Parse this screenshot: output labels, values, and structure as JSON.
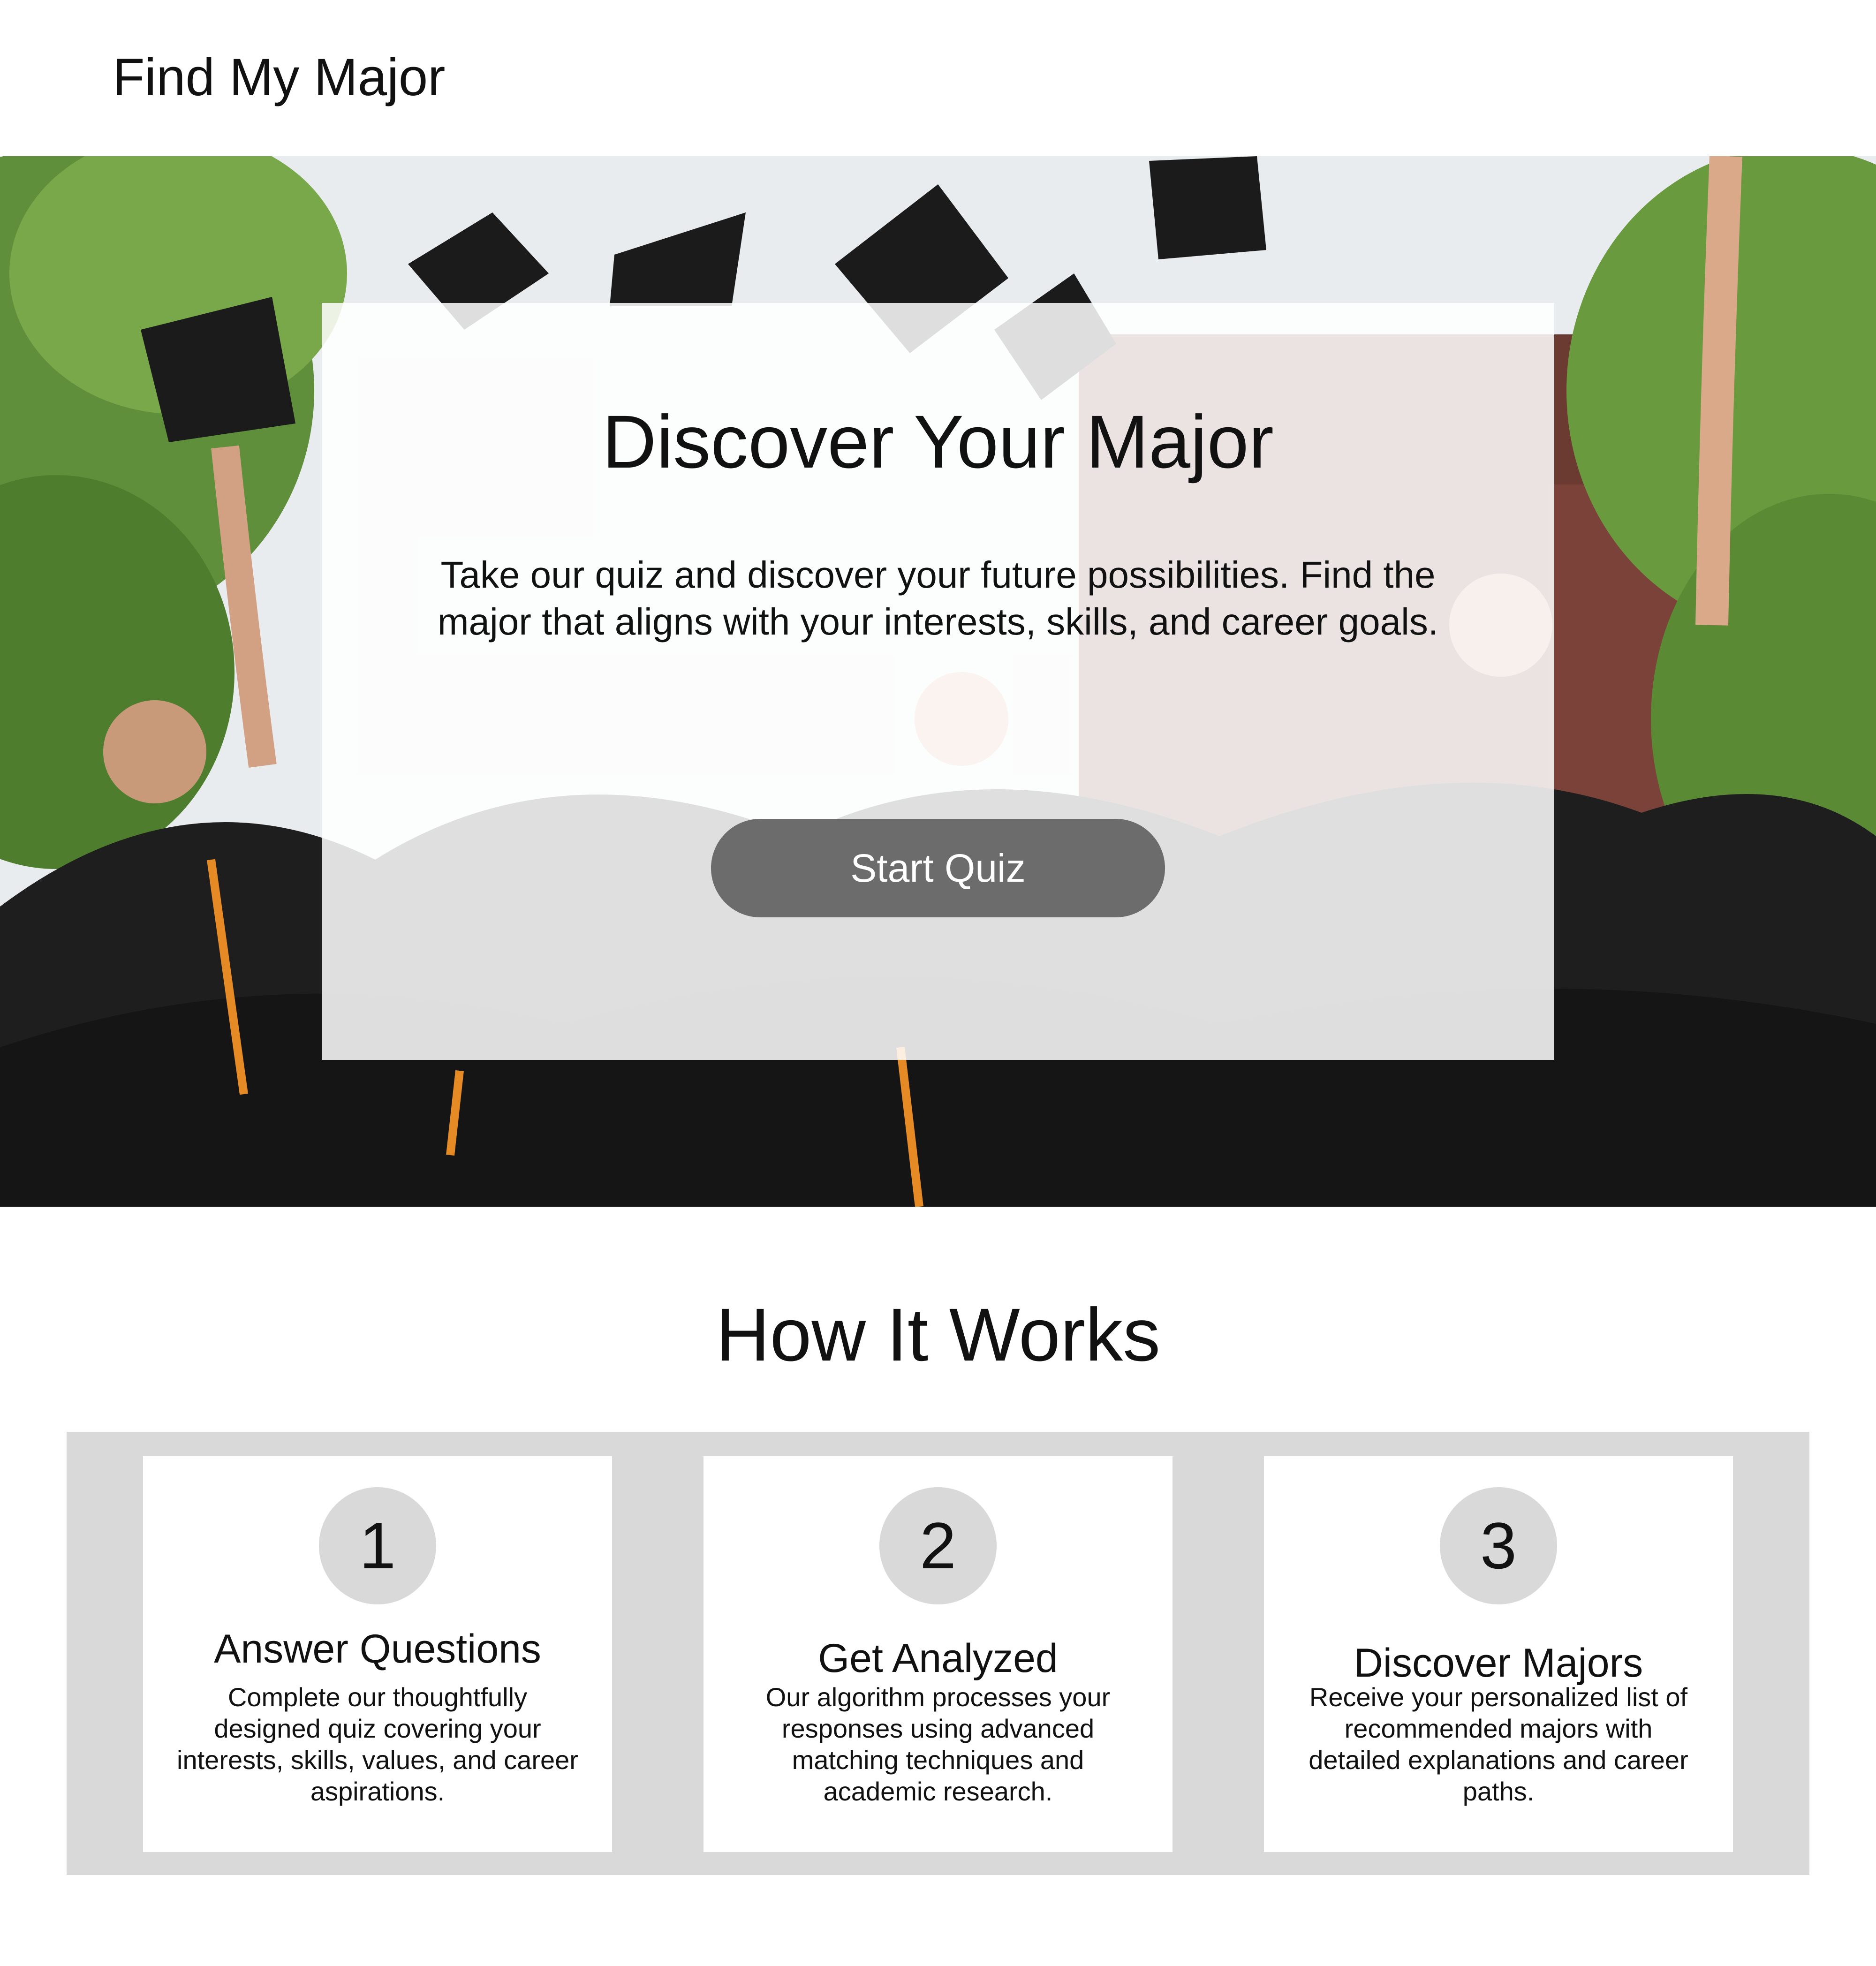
{
  "header": {
    "site_title": "Find My Major"
  },
  "hero": {
    "heading": "Discover Your Major",
    "text": "Take our quiz and discover your future possibilities. Find the major that aligns with your interests, skills, and career goals.",
    "button_label": "Start Quiz"
  },
  "how_it_works": {
    "heading": "How It Works",
    "steps": [
      {
        "number": "1",
        "title": "Answer Questions",
        "description": "Complete our thoughtfully designed quiz covering your interests, skills, values, and career aspirations."
      },
      {
        "number": "2",
        "title": "Get Analyzed",
        "description": "Our algorithm processes your responses using advanced matching techniques and academic research."
      },
      {
        "number": "3",
        "title": "Discover Majors",
        "description": "Receive your personalized list of recommended majors with detailed explanations and career paths."
      }
    ]
  },
  "colors": {
    "button_bg": "#6c6c6c",
    "panel_bg": "#d9d9d9",
    "card_bg": "#ffffff",
    "text": "#111111"
  }
}
